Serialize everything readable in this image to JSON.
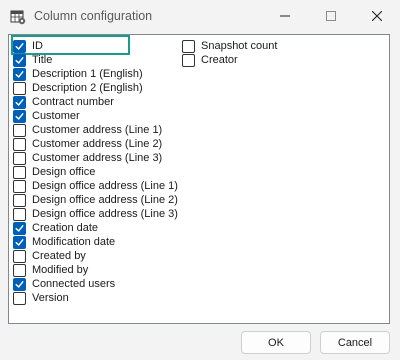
{
  "window": {
    "title": "Column configuration",
    "icon": "table-settings-icon",
    "controls": [
      "minimize-icon",
      "maximize-icon",
      "close-icon"
    ]
  },
  "columns_left": [
    {
      "label": "ID",
      "checked": true,
      "focused": true
    },
    {
      "label": "Title",
      "checked": true
    },
    {
      "label": "Description 1 (English)",
      "checked": true
    },
    {
      "label": "Description 2 (English)",
      "checked": false
    },
    {
      "label": "Contract number",
      "checked": true
    },
    {
      "label": "Customer",
      "checked": true
    },
    {
      "label": "Customer address (Line 1)",
      "checked": false
    },
    {
      "label": "Customer address (Line 2)",
      "checked": false
    },
    {
      "label": "Customer address (Line 3)",
      "checked": false
    },
    {
      "label": "Design office",
      "checked": false
    },
    {
      "label": "Design office address (Line 1)",
      "checked": false
    },
    {
      "label": "Design office address (Line 2)",
      "checked": false
    },
    {
      "label": "Design office address (Line 3)",
      "checked": false
    },
    {
      "label": "Creation date",
      "checked": true
    },
    {
      "label": "Modification date",
      "checked": true
    },
    {
      "label": "Created by",
      "checked": false
    },
    {
      "label": "Modified by",
      "checked": false
    },
    {
      "label": "Connected users",
      "checked": true
    },
    {
      "label": "Version",
      "checked": false
    }
  ],
  "columns_right": [
    {
      "label": "Snapshot count",
      "checked": false
    },
    {
      "label": "Creator",
      "checked": false
    }
  ],
  "buttons": {
    "ok_label": "OK",
    "cancel_label": "Cancel"
  },
  "colors": {
    "accent": "#005fb8",
    "focus": "#1a9c8c"
  }
}
